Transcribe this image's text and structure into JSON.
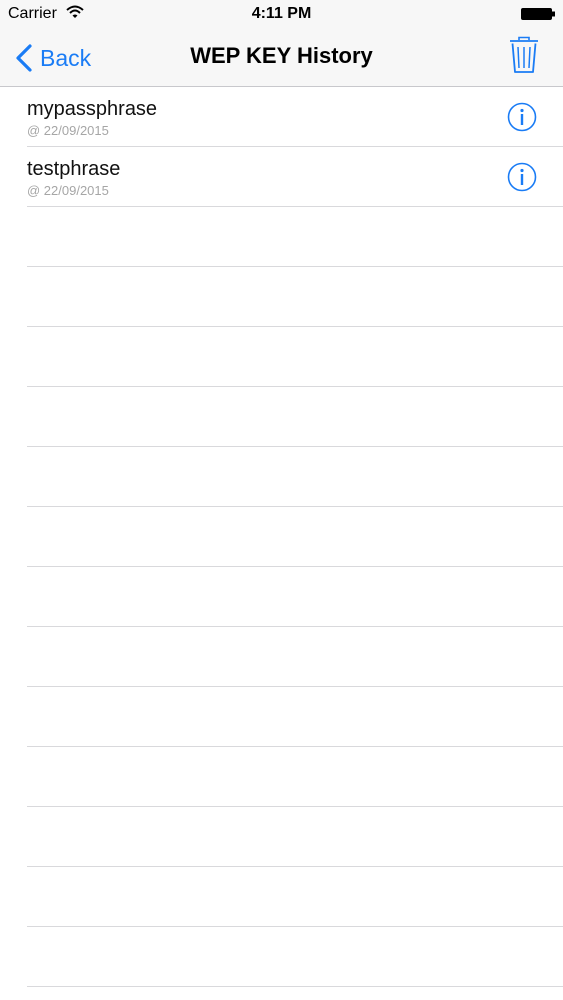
{
  "status_bar": {
    "carrier": "Carrier",
    "time": "4:11 PM",
    "wifi_icon": "wifi-icon",
    "battery_icon": "battery-full-icon"
  },
  "nav": {
    "back_label": "Back",
    "title": "WEP KEY History",
    "trash_icon": "trash-icon",
    "accent_color": "#1a7cf5"
  },
  "history": [
    {
      "name": "mypassphrase",
      "date": "@ 22/09/2015"
    },
    {
      "name": "testphrase",
      "date": "@ 22/09/2015"
    }
  ]
}
